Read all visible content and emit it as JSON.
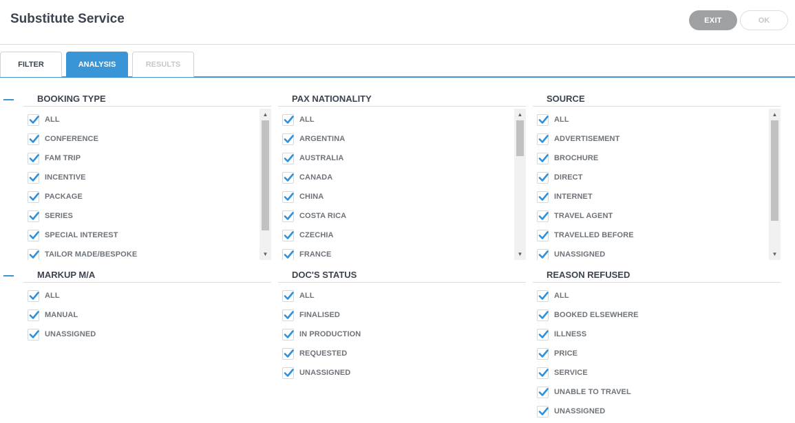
{
  "header": {
    "title": "Substitute Service",
    "exit_label": "EXIT",
    "ok_label": "OK"
  },
  "tabs": [
    {
      "label": "FILTER"
    },
    {
      "label": "ANALYSIS"
    },
    {
      "label": "RESULTS"
    }
  ],
  "accent_color": "#3a95d6",
  "groups": {
    "booking_type": {
      "title": "BOOKING TYPE",
      "items": [
        "ALL",
        "CONFERENCE",
        "FAM TRIP",
        "INCENTIVE",
        "PACKAGE",
        "SERIES",
        "SPECIAL INTEREST",
        "TAILOR MADE/BESPOKE"
      ]
    },
    "pax_nationality": {
      "title": "PAX NATIONALITY",
      "items": [
        "ALL",
        "ARGENTINA",
        "AUSTRALIA",
        "CANADA",
        "CHINA",
        "COSTA RICA",
        "CZECHIA",
        "FRANCE"
      ]
    },
    "source": {
      "title": "SOURCE",
      "items": [
        "ALL",
        "ADVERTISEMENT",
        "BROCHURE",
        "DIRECT",
        "INTERNET",
        "TRAVEL AGENT",
        "TRAVELLED BEFORE",
        "UNASSIGNED"
      ]
    },
    "markup": {
      "title": "MARKUP M/A",
      "items": [
        "ALL",
        "MANUAL",
        "UNASSIGNED"
      ]
    },
    "docs_status": {
      "title": "DOC'S STATUS",
      "items": [
        "ALL",
        "FINALISED",
        "IN PRODUCTION",
        "REQUESTED",
        "UNASSIGNED"
      ]
    },
    "reason_refused": {
      "title": "REASON REFUSED",
      "items": [
        "ALL",
        "BOOKED ELSEWHERE",
        "ILLNESS",
        "PRICE",
        "SERVICE",
        "UNABLE TO TRAVEL",
        "UNASSIGNED"
      ]
    }
  }
}
